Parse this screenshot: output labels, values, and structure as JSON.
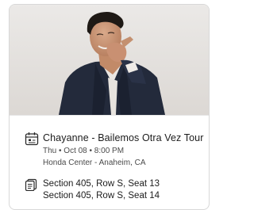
{
  "event": {
    "title": "Chayanne - Bailemos Otra Vez Tour",
    "datetime": "Thu • Oct 08 • 8:00 PM",
    "venue": "Honda Center - Anaheim, CA"
  },
  "tickets": {
    "seats": [
      "Section 405, Row S, Seat 13",
      "Section 405, Row S, Seat 14"
    ]
  },
  "icons": {
    "event": "calendar-icon",
    "tickets": "ticket-icon"
  },
  "colors": {
    "hero_background": "#e4e1de",
    "text_primary": "#1c1c1c",
    "text_secondary": "#4a4a4a",
    "border": "#d8d8d8"
  }
}
